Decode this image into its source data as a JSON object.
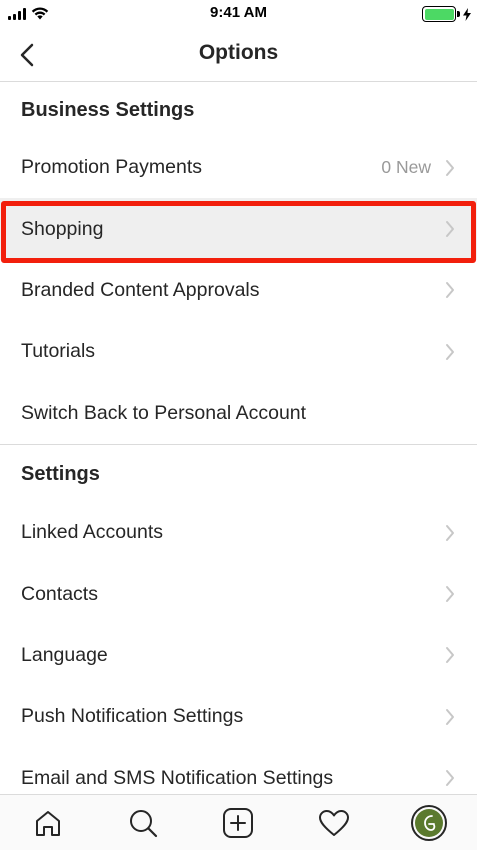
{
  "status_bar": {
    "time": "9:41 AM"
  },
  "nav": {
    "title": "Options"
  },
  "business_section": {
    "header": "Business Settings",
    "items": [
      {
        "label": "Promotion Payments",
        "detail": "0 New",
        "chevron": true
      },
      {
        "label": "Shopping",
        "detail": "",
        "chevron": true,
        "highlighted": true
      },
      {
        "label": "Branded Content Approvals",
        "detail": "",
        "chevron": true
      },
      {
        "label": "Tutorials",
        "detail": "",
        "chevron": true
      },
      {
        "label": "Switch Back to Personal Account",
        "detail": "",
        "chevron": false
      }
    ]
  },
  "settings_section": {
    "header": "Settings",
    "items": [
      {
        "label": "Linked Accounts",
        "chevron": true
      },
      {
        "label": "Contacts",
        "chevron": true
      },
      {
        "label": "Language",
        "chevron": true
      },
      {
        "label": "Push Notification Settings",
        "chevron": true
      },
      {
        "label": "Email and SMS Notification Settings",
        "chevron": true
      }
    ]
  },
  "tab_bar": {
    "tabs": [
      {
        "icon": "home-icon"
      },
      {
        "icon": "search-icon"
      },
      {
        "icon": "add-post-icon"
      },
      {
        "icon": "heart-icon"
      },
      {
        "icon": "profile-avatar"
      }
    ]
  },
  "colors": {
    "highlight_border": "#f21f0c",
    "battery": "#4cd964",
    "avatar_bg": "#5b7a2e"
  }
}
